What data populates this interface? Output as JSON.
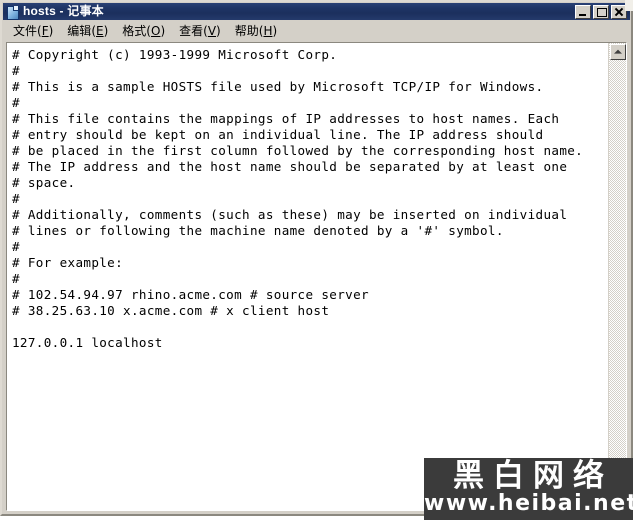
{
  "window": {
    "title": "hosts - 记事本",
    "icon": "notepad-document-icon",
    "controls": [
      {
        "name": "minimize",
        "label": "_"
      },
      {
        "name": "maximize",
        "label": "□"
      },
      {
        "name": "close",
        "label": "X"
      }
    ]
  },
  "menu": {
    "items": [
      {
        "name": "file",
        "text": "文件",
        "accel": "F"
      },
      {
        "name": "edit",
        "text": "编辑",
        "accel": "E"
      },
      {
        "name": "format",
        "text": "格式",
        "accel": "O"
      },
      {
        "name": "view",
        "text": "查看",
        "accel": "V"
      },
      {
        "name": "help",
        "text": "帮助",
        "accel": "H"
      }
    ]
  },
  "editor": {
    "content": "# Copyright (c) 1993-1999 Microsoft Corp.\n#\n# This is a sample HOSTS file used by Microsoft TCP/IP for Windows.\n#\n# This file contains the mappings of IP addresses to host names. Each\n# entry should be kept on an individual line. The IP address should\n# be placed in the first column followed by the corresponding host name.\n# The IP address and the host name should be separated by at least one\n# space.\n#\n# Additionally, comments (such as these) may be inserted on individual\n# lines or following the machine name denoted by a '#' symbol.\n#\n# For example:\n#\n# 102.54.94.97 rhino.acme.com # source server\n# 38.25.63.10 x.acme.com # x client host\n\n127.0.0.1 localhost"
  },
  "scrollbar": {
    "up_arrow": "▲",
    "down_arrow": "▼"
  },
  "watermark": {
    "chinese": "黑白网络",
    "url": "www.heibai.net"
  },
  "colors": {
    "title_bar": "#1f3566",
    "window_face": "#d4d0c8",
    "text_background": "#ffffff",
    "text_foreground": "#000000",
    "watermark_background": "#3b3b3b",
    "watermark_foreground": "#ffffff"
  }
}
